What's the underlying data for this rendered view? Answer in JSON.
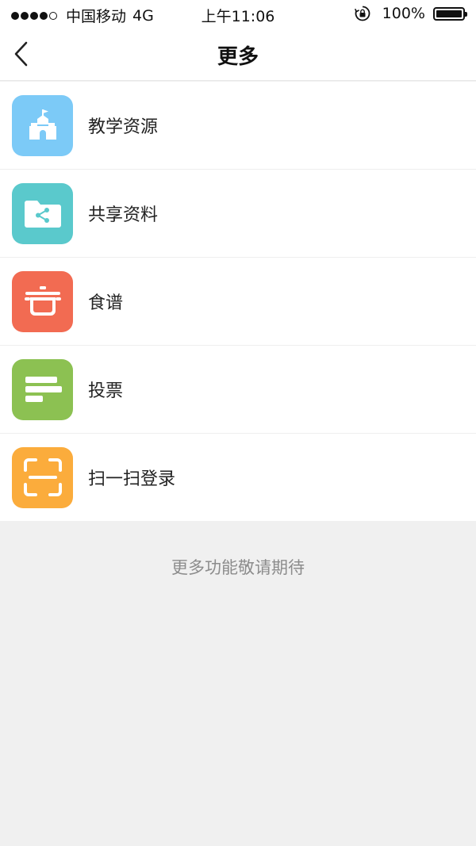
{
  "status_bar": {
    "carrier": "中国移动",
    "network": "4G",
    "time": "上午11:06",
    "battery_percent": "100%",
    "battery_level": 1.0
  },
  "nav": {
    "title": "更多"
  },
  "menu": {
    "items": [
      {
        "label": "教学资源",
        "icon": "school-building-icon",
        "color": "#7ccaf7"
      },
      {
        "label": "共享资料",
        "icon": "shared-folder-icon",
        "color": "#5ac9cc"
      },
      {
        "label": "食谱",
        "icon": "cooking-pot-icon",
        "color": "#f26b52"
      },
      {
        "label": "投票",
        "icon": "vote-bars-icon",
        "color": "#8cc152"
      },
      {
        "label": "扫一扫登录",
        "icon": "scan-frame-icon",
        "color": "#fbac3c"
      }
    ]
  },
  "footer": {
    "note": "更多功能敬请期待"
  }
}
